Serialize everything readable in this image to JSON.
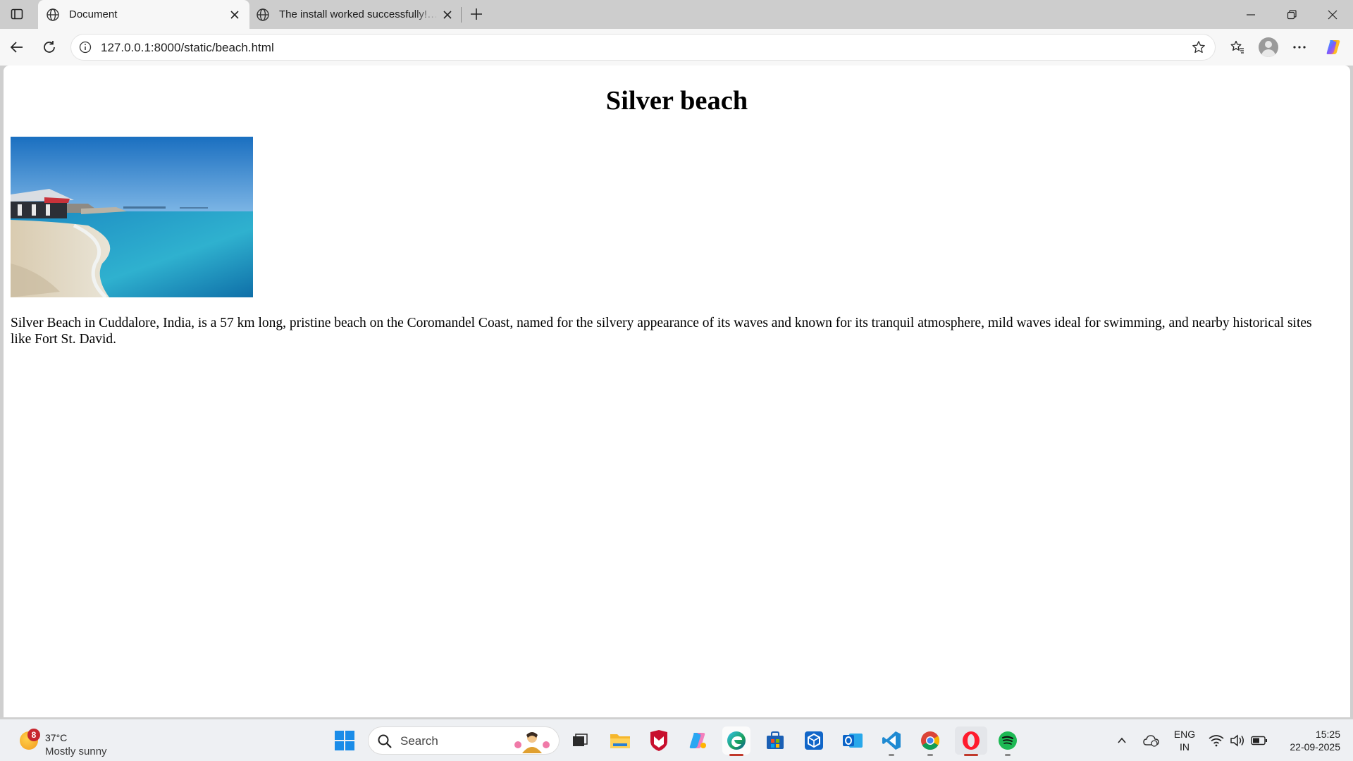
{
  "browser": {
    "tabs": [
      {
        "title": "Document",
        "active": true
      },
      {
        "title": "The install worked successfully! Congratulations!",
        "active": false
      }
    ],
    "address_bar": {
      "url": "127.0.0.1:8000/static/beach.html"
    }
  },
  "page": {
    "heading": "Silver beach",
    "image_subject": "beach photo with blue sea and a hut on the shore",
    "paragraph": "Silver Beach in Cuddalore, India, is a 57 km long, pristine beach on the Coromandel Coast, named for the silvery appearance of its waves and known for its tranquil atmosphere, mild waves ideal for swimming, and nearby historical sites like Fort St. David."
  },
  "taskbar": {
    "weather": {
      "badge": "8",
      "temperature": "37°C",
      "condition": "Mostly sunny"
    },
    "search_placeholder": "Search",
    "apps": [
      "start-icon",
      "search-icon",
      "task-view-icon",
      "file-explorer-icon",
      "mcafee-icon",
      "copilot-icon",
      "edge-icon",
      "microsoft-store-icon",
      "dev-tool-icon",
      "outlook-icon",
      "vscode-icon",
      "chrome-icon",
      "opera-icon",
      "spotify-icon"
    ],
    "language": {
      "line1": "ENG",
      "line2": "IN"
    },
    "clock": {
      "time": "15:25",
      "date": "22-09-2025"
    }
  },
  "colors": {
    "accent_blue": "#0a64c8",
    "tab_active_bg": "#f7f7f7",
    "tab_strip_bg": "#cdcdcd",
    "taskbar_bg": "#eef0f3"
  }
}
